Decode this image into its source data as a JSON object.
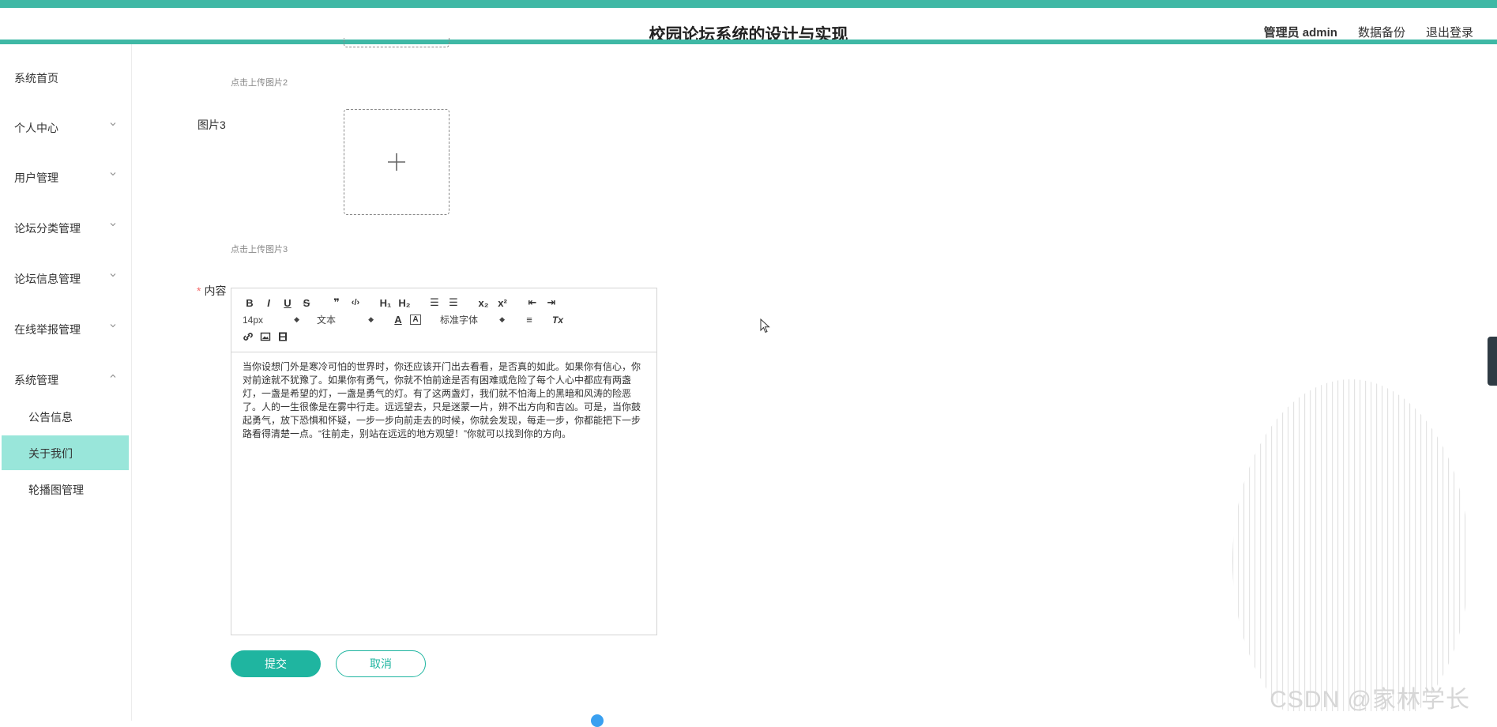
{
  "header": {
    "title": "校园论坛系统的设计与实现",
    "admin_label": "管理员 admin",
    "backup_label": "数据备份",
    "logout_label": "退出登录"
  },
  "sidebar": {
    "items": [
      {
        "label": "系统首页"
      },
      {
        "label": "个人中心"
      },
      {
        "label": "用户管理"
      },
      {
        "label": "论坛分类管理"
      },
      {
        "label": "论坛信息管理"
      },
      {
        "label": "在线举报管理"
      },
      {
        "label": "系统管理"
      }
    ],
    "sub_items": [
      {
        "label": "公告信息"
      },
      {
        "label": "关于我们"
      },
      {
        "label": "轮播图管理"
      }
    ]
  },
  "form": {
    "upload_hint_2": "点击上传图片2",
    "image3_label": "图片3",
    "upload_hint_3": "点击上传图片3",
    "content_label": "内容",
    "required_mark": "*"
  },
  "editor": {
    "toolbar": {
      "bold": "B",
      "italic": "I",
      "underline": "U",
      "strike": "S",
      "quote": "❞",
      "code": "‹/›",
      "h1": "H₁",
      "h2": "H₂",
      "ordered_list": "☰",
      "bullet_list": "☰",
      "subscript": "x₂",
      "superscript": "x²",
      "outdent": "⇤",
      "indent": "⇥",
      "font_size": "14px",
      "text_type": "文本",
      "font_color": "A",
      "bg_color": "A",
      "font_family": "标准字体",
      "align": "≡",
      "clear": "Tx"
    },
    "content": "当你设想门外是寒冷可怕的世界时，你还应该开门出去看看，是否真的如此。如果你有信心，你对前途就不犹豫了。如果你有勇气，你就不怕前途是否有困难或危险了每个人心中都应有两盏灯，一盏是希望的灯，一盏是勇气的灯。有了这两盏灯，我们就不怕海上的黑暗和风涛的险恶了。人的一生很像是在雾中行走。远远望去，只是迷蒙一片，辨不出方向和吉凶。可是，当你鼓起勇气，放下恐惧和怀疑，一步一步向前走去的时候，你就会发现，每走一步，你都能把下一步路看得清楚一点。“往前走，别站在远远的地方观望！”你就可以找到你的方向。"
  },
  "buttons": {
    "submit": "提交",
    "cancel": "取消"
  },
  "watermark": "CSDN @家林学长",
  "colors": {
    "accent": "#3fb8a5",
    "primary_button": "#1fb5a0",
    "active_menu": "#99e6da"
  }
}
